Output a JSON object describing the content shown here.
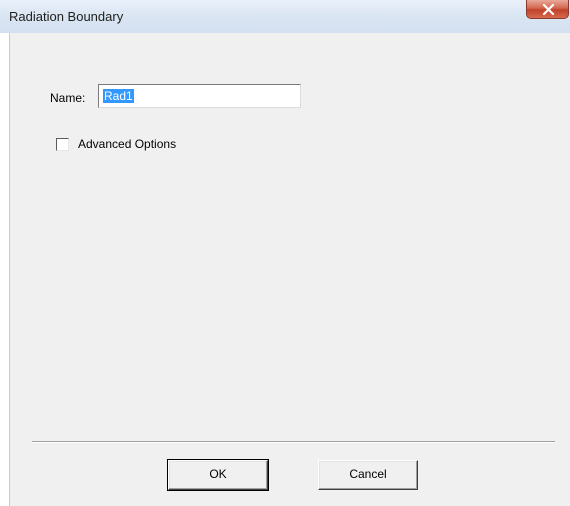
{
  "window": {
    "title": "Radiation Boundary",
    "close_icon": "close-x-icon"
  },
  "form": {
    "name_label": "Name:",
    "name_value": "Rad1",
    "advanced_label": "Advanced Options",
    "advanced_checked": false
  },
  "buttons": {
    "ok_label": "OK",
    "cancel_label": "Cancel"
  },
  "colors": {
    "selection": "#3399ff",
    "close_button": "#c0422a",
    "dialog_background": "#f0f0f0"
  }
}
